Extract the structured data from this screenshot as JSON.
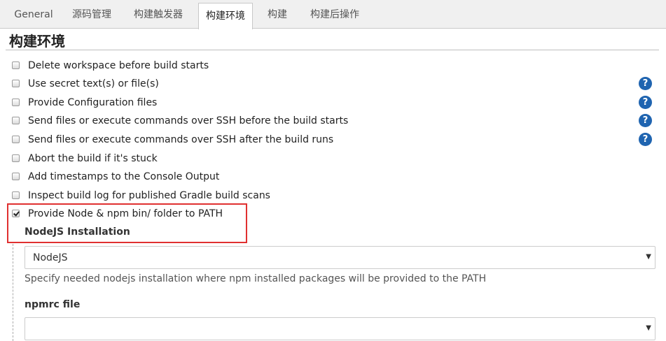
{
  "tabs": [
    {
      "label": "General",
      "active": false
    },
    {
      "label": "源码管理",
      "active": false
    },
    {
      "label": "构建触发器",
      "active": false
    },
    {
      "label": "构建环境",
      "active": true
    },
    {
      "label": "构建",
      "active": false
    },
    {
      "label": "构建后操作",
      "active": false
    }
  ],
  "section": {
    "title": "构建环境"
  },
  "options": [
    {
      "label": "Delete workspace before build starts",
      "checked": false,
      "help": false
    },
    {
      "label": "Use secret text(s) or file(s)",
      "checked": false,
      "help": true
    },
    {
      "label": "Provide Configuration files",
      "checked": false,
      "help": true
    },
    {
      "label": "Send files or execute commands over SSH before the build starts",
      "checked": false,
      "help": true
    },
    {
      "label": "Send files or execute commands over SSH after the build runs",
      "checked": false,
      "help": true
    },
    {
      "label": "Abort the build if it's stuck",
      "checked": false,
      "help": false
    },
    {
      "label": "Add timestamps to the Console Output",
      "checked": false,
      "help": false
    },
    {
      "label": "Inspect build log for published Gradle build scans",
      "checked": false,
      "help": false
    },
    {
      "label": "Provide Node & npm bin/ folder to PATH",
      "checked": true,
      "help": false
    }
  ],
  "help_icon_text": "?",
  "nodejs": {
    "installation_label": "NodeJS Installation",
    "installation_value": "NodeJS",
    "description": "Specify needed nodejs installation where npm installed packages will be provided to the PATH",
    "npmrc_label": "npmrc file",
    "npmrc_value": ""
  },
  "caret_icon": "▼",
  "colors": {
    "help_icon": "#1f64b0",
    "highlight": "#e03030",
    "tabbar_bg": "#f0f0f0"
  }
}
